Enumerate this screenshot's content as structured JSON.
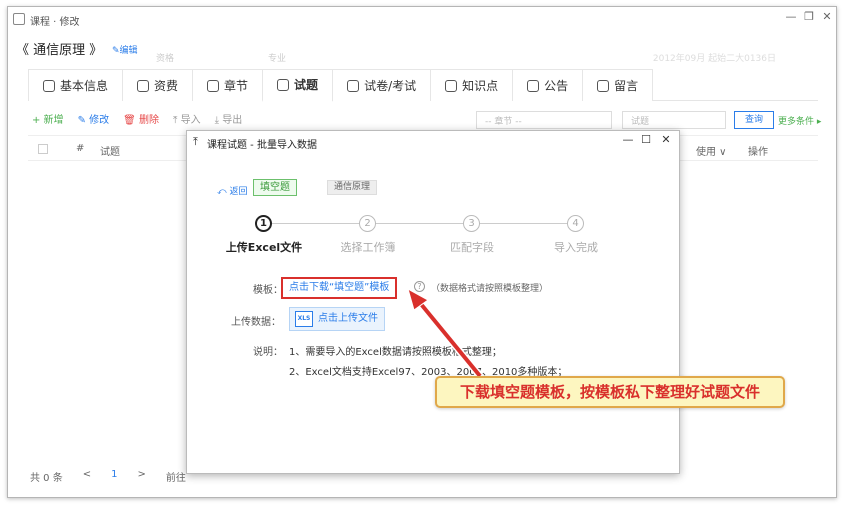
{
  "window": {
    "title": "课程 · 修改",
    "controls": [
      "—",
      "❐",
      "✕"
    ]
  },
  "header": {
    "course": "《 通信原理 》",
    "edit": "✎编辑",
    "ghost1": "资格",
    "ghost2": "专业",
    "ghost3": "2012年09月 起始二大0136日"
  },
  "tabs": [
    {
      "label": "基本信息"
    },
    {
      "label": "资费"
    },
    {
      "label": "章节"
    },
    {
      "label": "试题"
    },
    {
      "label": "试卷/考试"
    },
    {
      "label": "知识点"
    },
    {
      "label": "公告"
    },
    {
      "label": "留言"
    }
  ],
  "toolbar": {
    "add": "+ 新增",
    "mod": "✎ 修改",
    "del": "🗑 删除",
    "imp": "⤒ 导入",
    "exp": "⤓ 导出"
  },
  "filters": {
    "chapter": "-- 章节 --",
    "question": "试题",
    "query": "查询",
    "more": "更多条件 ▸"
  },
  "table": {
    "col_no": "#",
    "col_q": "试题",
    "col_use": "使用 ∨",
    "col_op": "操作"
  },
  "pager": {
    "total": "共 0 条",
    "prev": "<",
    "page": "1",
    "next": ">",
    "goto": "前往"
  },
  "dialog": {
    "title": "课程试题 - 批量导入数据",
    "back": "⤺ 返回",
    "type_tag": "填空题",
    "course_tag": "通信原理",
    "steps": [
      {
        "num": "1",
        "label": "上传Excel文件"
      },
      {
        "num": "2",
        "label": "选择工作簿"
      },
      {
        "num": "3",
        "label": "匹配字段"
      },
      {
        "num": "4",
        "label": "导入完成"
      }
    ],
    "template_label": "模板：",
    "template_link": "点击下载“填空题”模板",
    "template_hint": "（数据格式请按照模板整理）",
    "upload_label": "上传数据：",
    "upload_button": "点击上传文件",
    "upload_icon": "XLS",
    "note_label": "说明：",
    "note1": "1、需要导入的Excel数据请按照模板格式整理；",
    "note2": "2、Excel文档支持Excel97、2003、2007、2010多种版本；"
  },
  "callout": "下载填空题模板，按模板私下整理好试题文件"
}
